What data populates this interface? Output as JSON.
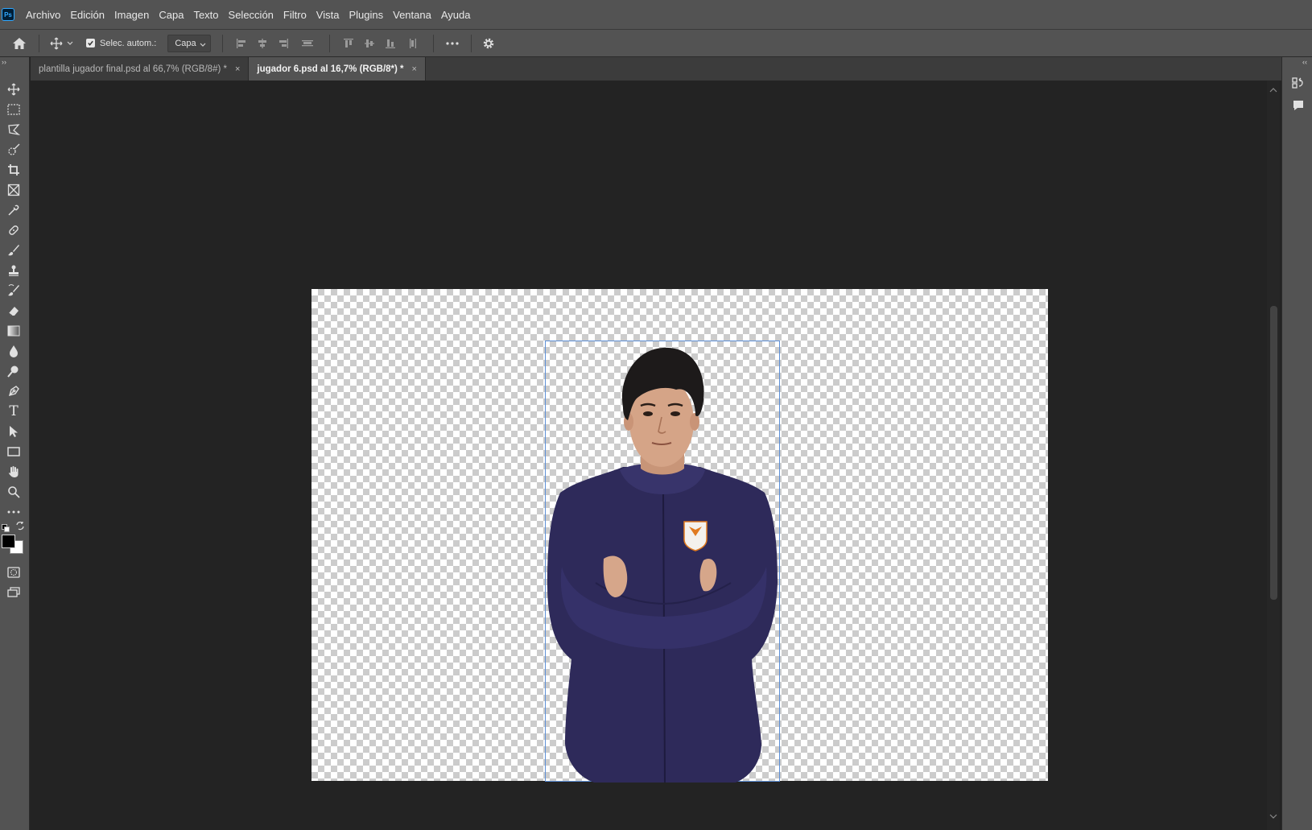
{
  "app": {
    "logo_text": "Ps"
  },
  "menu": [
    "Archivo",
    "Edición",
    "Imagen",
    "Capa",
    "Texto",
    "Selección",
    "Filtro",
    "Vista",
    "Plugins",
    "Ventana",
    "Ayuda"
  ],
  "options": {
    "auto_select_label": "Selec. autom.:",
    "auto_select_checked": true,
    "auto_select_target": "Capa"
  },
  "tabs": [
    {
      "label": "plantilla jugador final.psd al 66,7% (RGB/8#) *",
      "close": "×",
      "active": false
    },
    {
      "label": "jugador 6.psd al 16,7% (RGB/8*) *",
      "close": "×",
      "active": true
    }
  ],
  "tools": [
    "move-tool",
    "marquee-tool",
    "lasso-tool",
    "quick-selection-tool",
    "crop-tool",
    "frame-tool",
    "eyedropper-tool",
    "healing-brush-tool",
    "brush-tool",
    "clone-stamp-tool",
    "history-brush-tool",
    "eraser-tool",
    "gradient-tool",
    "blur-tool",
    "dodge-tool",
    "pen-tool",
    "type-tool",
    "path-selection-tool",
    "rectangle-tool",
    "hand-tool",
    "zoom-tool",
    "more-tools"
  ],
  "colors": {
    "foreground": "#000000",
    "background": "#ffffff",
    "selection_border": "#5d8fd6",
    "jacket": "#2e2a5a"
  }
}
